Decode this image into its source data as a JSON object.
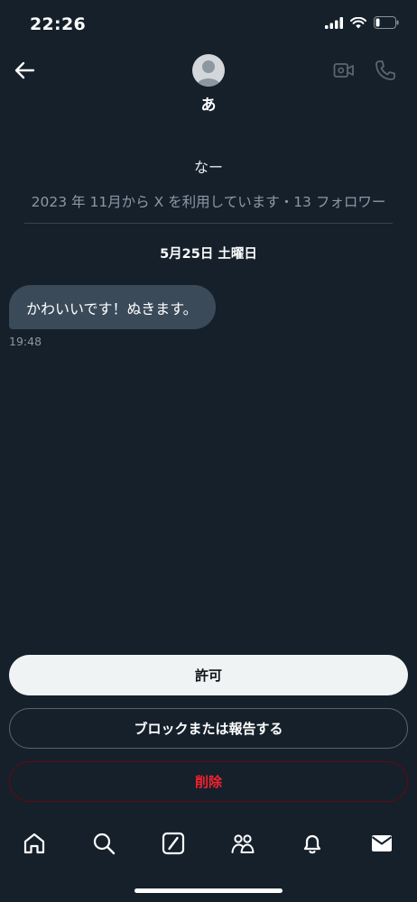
{
  "status_bar": {
    "time": "22:26"
  },
  "header": {
    "name": "あ"
  },
  "profile": {
    "bio": "なー",
    "meta": "2023 年 11月から X を利用しています・13 フォロワー"
  },
  "conversation": {
    "date_label": "5月25日 土曜日",
    "messages": [
      {
        "text": "かわいいです！ぬきます。",
        "time": "19:48"
      }
    ]
  },
  "actions": {
    "allow": "許可",
    "block_or_report": "ブロックまたは報告する",
    "delete": "削除"
  },
  "tabs": [
    "home-icon",
    "search-icon",
    "grok-icon",
    "communities-icon",
    "notifications-icon",
    "messages-icon"
  ],
  "colors": {
    "background": "#15202b",
    "bubble": "#3a4a59",
    "danger": "#f4212e",
    "muted": "#8b98a5"
  }
}
